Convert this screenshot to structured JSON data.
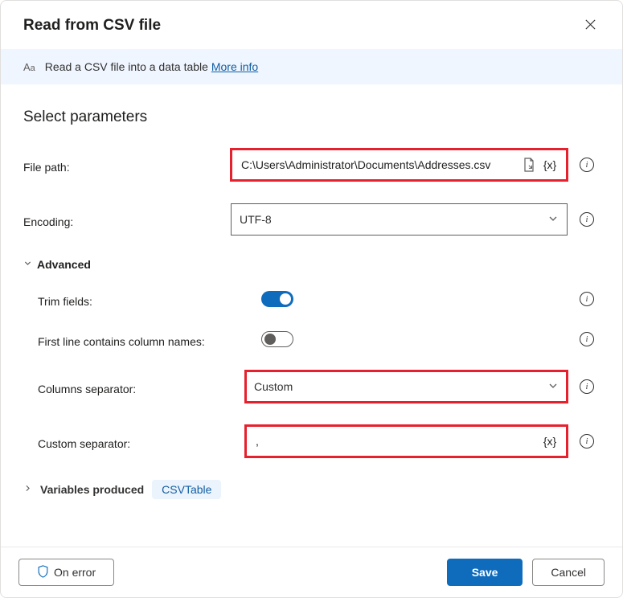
{
  "title": "Read from CSV file",
  "banner": {
    "text": "Read a CSV file into a data table ",
    "link": "More info"
  },
  "section_title": "Select parameters",
  "filePath": {
    "label": "File path:",
    "value": "C:\\Users\\Administrator\\Documents\\Addresses.csv"
  },
  "encoding": {
    "label": "Encoding:",
    "value": "UTF-8"
  },
  "advanced": {
    "label": "Advanced",
    "trim": {
      "label": "Trim fields:",
      "on": true
    },
    "firstLine": {
      "label": "First line contains column names:",
      "on": false
    },
    "separator": {
      "label": "Columns separator:",
      "value": "Custom"
    },
    "custom": {
      "label": "Custom separator:",
      "value": ","
    }
  },
  "varsProduced": {
    "label": "Variables produced",
    "badge": "CSVTable"
  },
  "footer": {
    "onError": "On error",
    "save": "Save",
    "cancel": "Cancel"
  }
}
